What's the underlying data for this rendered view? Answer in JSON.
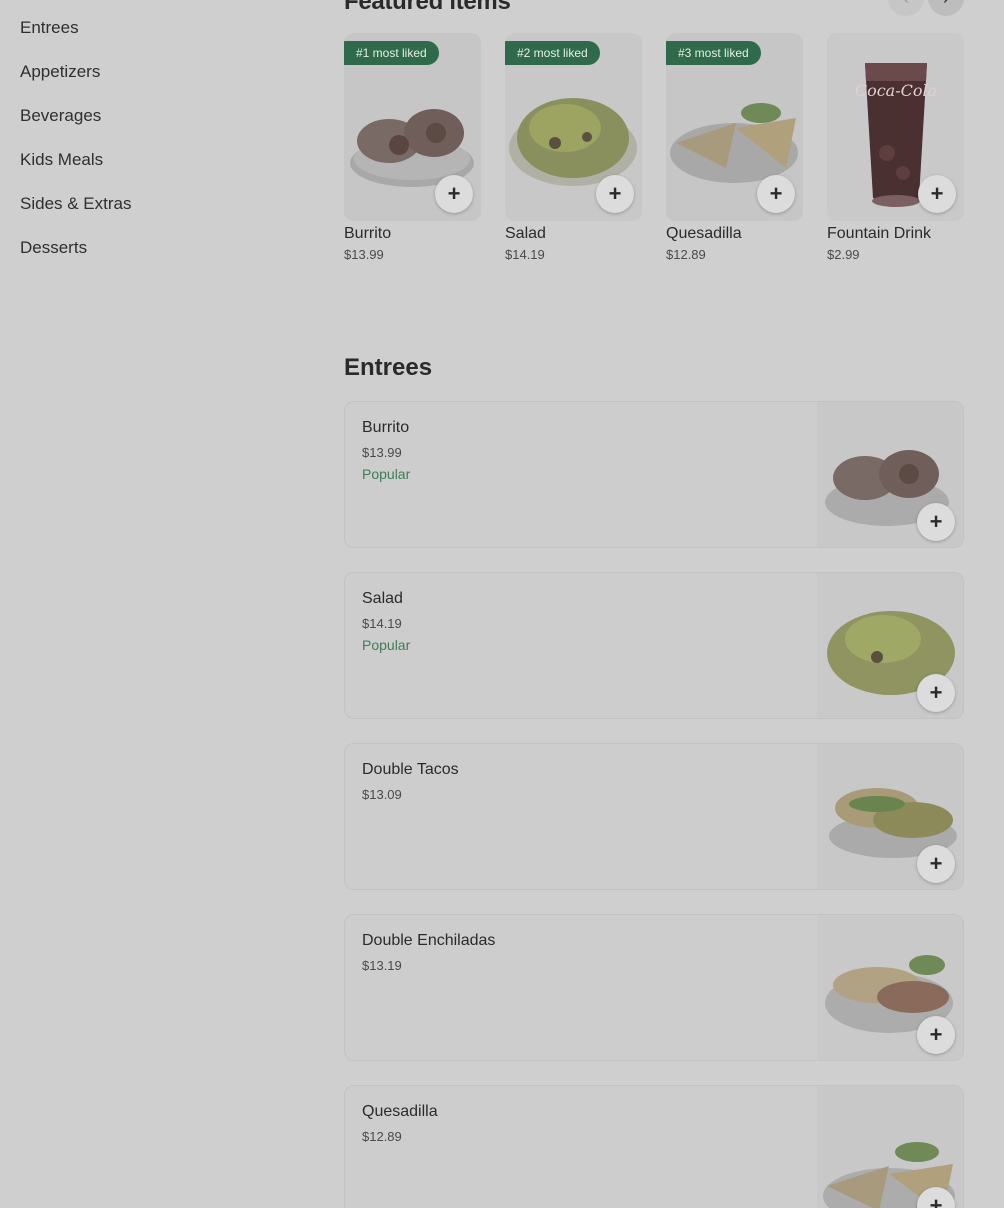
{
  "sidebar": {
    "items": [
      {
        "label": "Entrees"
      },
      {
        "label": "Appetizers"
      },
      {
        "label": "Beverages"
      },
      {
        "label": "Kids Meals"
      },
      {
        "label": "Sides & Extras"
      },
      {
        "label": "Desserts"
      }
    ]
  },
  "featured": {
    "title": "Featured items",
    "prev_icon": "chevron-left-icon",
    "next_icon": "chevron-right-icon",
    "cards": [
      {
        "badge": "#1 most liked",
        "name": "Burrito",
        "price": "$13.99"
      },
      {
        "badge": "#2 most liked",
        "name": "Salad",
        "price": "$14.19"
      },
      {
        "badge": "#3 most liked",
        "name": "Quesadilla",
        "price": "$12.89"
      },
      {
        "badge": "",
        "name": "Fountain Drink",
        "price": "$2.99",
        "image_text": "Coca-Cola"
      }
    ]
  },
  "section": {
    "title": "Entrees",
    "items": [
      {
        "name": "Burrito",
        "price": "$13.99",
        "tag": "Popular"
      },
      {
        "name": "Salad",
        "price": "$14.19",
        "tag": "Popular"
      },
      {
        "name": "Double Tacos",
        "price": "$13.09",
        "tag": ""
      },
      {
        "name": "Double Enchiladas",
        "price": "$13.19",
        "tag": ""
      },
      {
        "name": "Quesadilla",
        "price": "$12.89",
        "tag": ""
      }
    ]
  },
  "add_button_glyph": "+",
  "colors": {
    "overlay_bg": "#cfcfcf",
    "badge_bg": "#2f6b4b",
    "popular_tag": "#3f7d57"
  }
}
